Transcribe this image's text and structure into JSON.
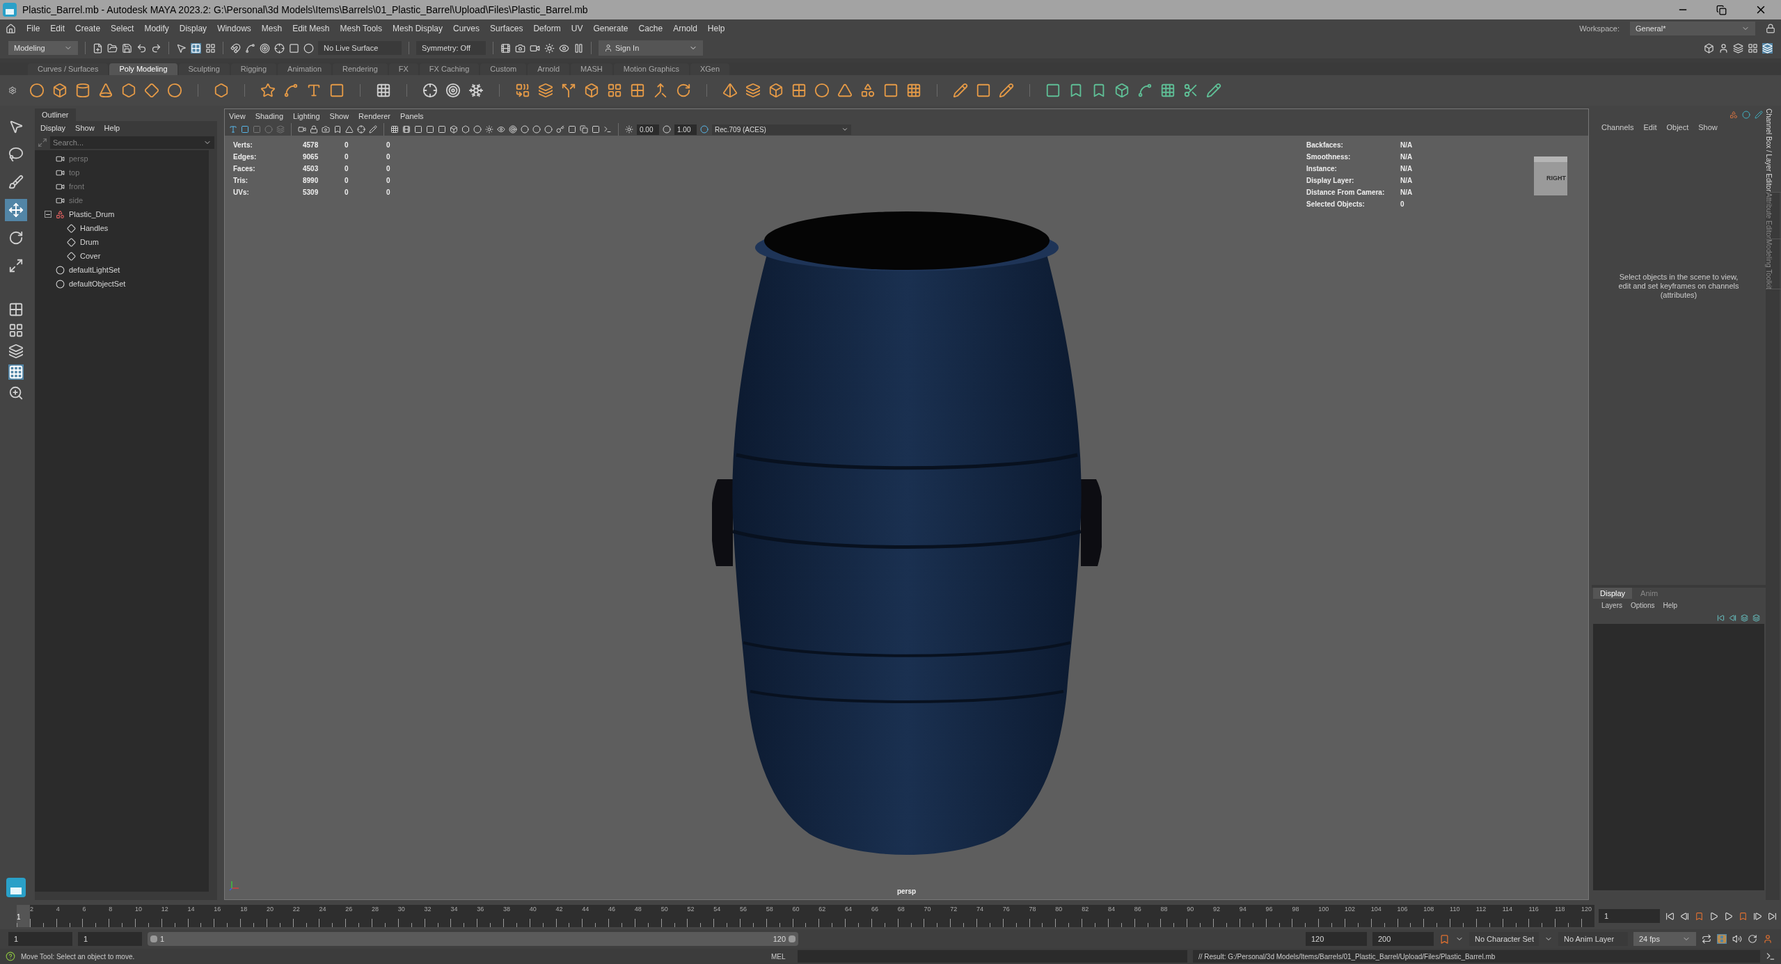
{
  "window": {
    "title": "Plastic_Barrel.mb - Autodesk MAYA 2023.2: G:\\Personal\\3d Models\\Items\\Barrels\\01_Plastic_Barrel\\Upload\\Files\\Plastic_Barrel.mb"
  },
  "menu_bar": [
    "File",
    "Edit",
    "Create",
    "Select",
    "Modify",
    "Display",
    "Windows",
    "Mesh",
    "Edit Mesh",
    "Mesh Tools",
    "Mesh Display",
    "Curves",
    "Surfaces",
    "Deform",
    "UV",
    "Generate",
    "Cache",
    "Arnold",
    "Help"
  ],
  "workspace": {
    "label": "Workspace:",
    "value": "General*"
  },
  "status_line": {
    "mode": "Modeling",
    "live_surface": "No Live Surface",
    "symmetry": "Symmetry: Off",
    "sign_in": "Sign In"
  },
  "shelf_tabs": [
    {
      "label": "Curves / Surfaces",
      "selected": false
    },
    {
      "label": "Poly Modeling",
      "selected": true
    },
    {
      "label": "Sculpting",
      "selected": false
    },
    {
      "label": "Rigging",
      "selected": false
    },
    {
      "label": "Animation",
      "selected": false
    },
    {
      "label": "Rendering",
      "selected": false
    },
    {
      "label": "FX",
      "selected": false
    },
    {
      "label": "FX Caching",
      "selected": false
    },
    {
      "label": "Custom",
      "selected": false
    },
    {
      "label": "Arnold",
      "selected": false
    },
    {
      "label": "MASH",
      "selected": false
    },
    {
      "label": "Motion Graphics",
      "selected": false
    },
    {
      "label": "XGen",
      "selected": false
    }
  ],
  "toolbox": [
    {
      "selected": false
    },
    {
      "selected": false
    },
    {
      "selected": false
    },
    {
      "selected": true
    },
    {
      "selected": false
    },
    {
      "selected": false
    }
  ],
  "outliner": {
    "title": "Outliner",
    "menu": [
      "Display",
      "Show",
      "Help"
    ],
    "search": {
      "placeholder": "Search..."
    },
    "items": [
      {
        "kind": "camera",
        "label": "persp",
        "dimmed": true
      },
      {
        "kind": "camera",
        "label": "top",
        "dimmed": true
      },
      {
        "kind": "camera",
        "label": "front",
        "dimmed": true
      },
      {
        "kind": "camera",
        "label": "side",
        "dimmed": true
      },
      {
        "kind": "group",
        "label": "Plastic_Drum",
        "dimmed": false,
        "expanded": true,
        "children": [
          {
            "kind": "mesh",
            "label": "Handles",
            "dimmed": false
          },
          {
            "kind": "mesh",
            "label": "Drum",
            "dimmed": false
          },
          {
            "kind": "mesh",
            "label": "Cover",
            "dimmed": false
          }
        ]
      },
      {
        "kind": "set",
        "label": "defaultLightSet",
        "dimmed": false
      },
      {
        "kind": "set",
        "label": "defaultObjectSet",
        "dimmed": false
      }
    ]
  },
  "viewport": {
    "menu": [
      "View",
      "Shading",
      "Lighting",
      "Show",
      "Renderer",
      "Panels"
    ],
    "exposure": "0.00",
    "gamma": "1.00",
    "color_space": "Rec.709 (ACES)",
    "hud_left": [
      {
        "label": "Verts:",
        "values": [
          "4578",
          "0",
          "0"
        ]
      },
      {
        "label": "Edges:",
        "values": [
          "9065",
          "0",
          "0"
        ]
      },
      {
        "label": "Faces:",
        "values": [
          "4503",
          "0",
          "0"
        ]
      },
      {
        "label": "Tris:",
        "values": [
          "8990",
          "0",
          "0"
        ]
      },
      {
        "label": "UVs:",
        "values": [
          "5309",
          "0",
          "0"
        ]
      }
    ],
    "hud_right": [
      {
        "label": "Backfaces:",
        "value": "N/A"
      },
      {
        "label": "Smoothness:",
        "value": "N/A"
      },
      {
        "label": "Instance:",
        "value": "N/A"
      },
      {
        "label": "Display Layer:",
        "value": "N/A"
      },
      {
        "label": "Distance From Camera:",
        "value": "N/A"
      },
      {
        "label": "Selected Objects:",
        "value": "0"
      }
    ],
    "view_cube_label": "RIGHT",
    "camera": "persp"
  },
  "channel_box": {
    "menu": [
      "Channels",
      "Edit",
      "Object",
      "Show"
    ],
    "message": "Select objects in the scene to view, edit and set keyframes on channels (attributes)"
  },
  "layer_editor": {
    "tabs": [
      {
        "label": "Display",
        "selected": true
      },
      {
        "label": "Anim",
        "selected": false
      }
    ],
    "menu": [
      "Layers",
      "Options",
      "Help"
    ]
  },
  "side_tabs": [
    {
      "label": "Channel Box / Layer Editor",
      "selected": true
    },
    {
      "label": "Attribute Editor",
      "selected": false
    },
    {
      "label": "Modeling Toolkit",
      "selected": false
    }
  ],
  "timeline": {
    "current_frame": "1",
    "labels": [
      "2",
      "4",
      "6",
      "8",
      "10",
      "12",
      "14",
      "16",
      "18",
      "20",
      "22",
      "24",
      "26",
      "28",
      "30",
      "32",
      "34",
      "36",
      "38",
      "40",
      "42",
      "44",
      "46",
      "48",
      "50",
      "52",
      "54",
      "56",
      "58",
      "60",
      "62",
      "64",
      "66",
      "68",
      "70",
      "72",
      "74",
      "76",
      "78",
      "80",
      "82",
      "84",
      "86",
      "88",
      "90",
      "92",
      "94",
      "96",
      "98",
      "100",
      "102",
      "104",
      "106",
      "108",
      "110",
      "112",
      "114",
      "116",
      "118",
      "120"
    ],
    "frame_field": "1"
  },
  "range": {
    "slider": {
      "level": 1
    },
    "start": "1",
    "playback_start": "1",
    "slider_start": "1",
    "slider_end": "120",
    "playback_end": "120",
    "end": "200",
    "character_set": "No Character Set",
    "anim_layer": "No Anim Layer",
    "fps": "24 fps"
  },
  "command_line": {
    "help": "Move Tool: Select an object to move.",
    "language": "MEL",
    "result": "// Result: G:/Personal/3d Models/Items/Barrels/01_Plastic_Barrel/Upload/Files/Plastic_Barrel.mb"
  }
}
